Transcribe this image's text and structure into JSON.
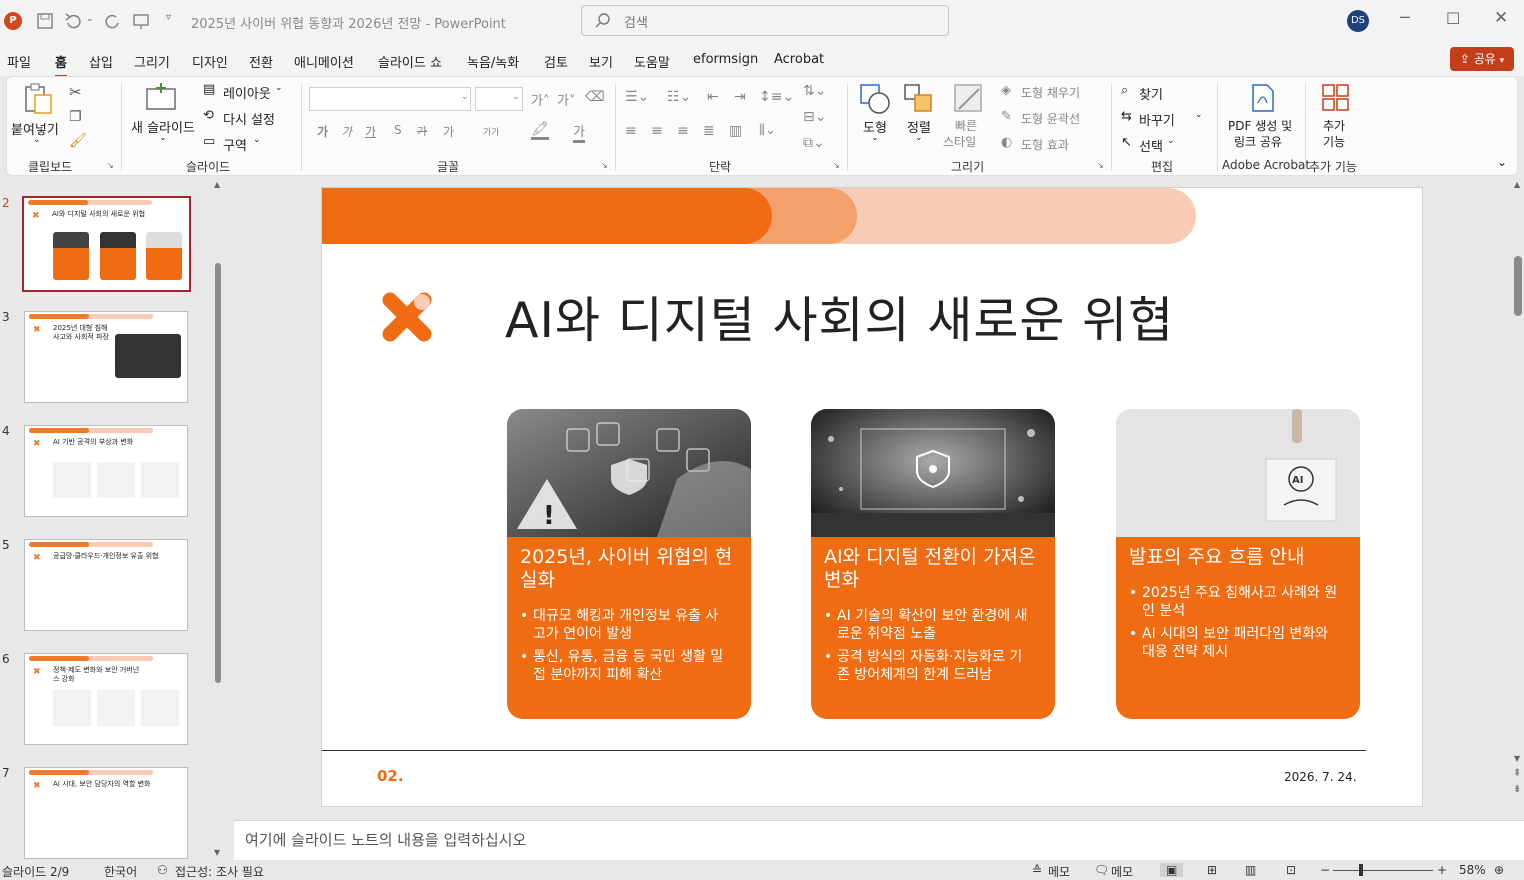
{
  "app": {
    "title": "2025년 사이버 위협 동향과 2026년 전망  -  PowerPoint",
    "search_placeholder": "검색",
    "user_initials": "DS",
    "share_label": "공유"
  },
  "menu": [
    "파일",
    "홈",
    "삽입",
    "그리기",
    "디자인",
    "전환",
    "애니메이션",
    "슬라이드 쇼",
    "녹음/녹화",
    "검토",
    "보기",
    "도움말",
    "eformsign",
    "Acrobat"
  ],
  "ribbon": {
    "paste": "붙여넣기",
    "new_slide": "새 슬라이드",
    "layout": "레이아웃",
    "reset": "다시 설정",
    "section": "구역",
    "font_buttons": [
      "가",
      "가",
      "가",
      "S",
      "가",
      "가",
      "가가"
    ],
    "shapes": "도형",
    "arrange": "정렬",
    "quick_styles_1": "빠른",
    "quick_styles_2": "스타일",
    "shape_fill": "도형 채우기",
    "shape_outline": "도형 윤곽선",
    "shape_effect": "도형 효과",
    "find": "찾기",
    "replace": "바꾸기",
    "select": "선택",
    "pdf_1": "PDF 생성 및",
    "pdf_2": "링크 공유",
    "addins_1": "추가",
    "addins_2": "기능",
    "groups": [
      "클립보드",
      "슬라이드",
      "글꼴",
      "단락",
      "그리기",
      "편집",
      "Adobe Acrobat",
      "추가 기능"
    ]
  },
  "thumbnails": [
    {
      "num": "2",
      "title": "AI와 디지털 사회의 새로운 위협"
    },
    {
      "num": "3",
      "title": "2025년 대형 침해사고와 사회적 파장"
    },
    {
      "num": "4",
      "title": "AI 기반 공격의 부상과 변화"
    },
    {
      "num": "5",
      "title": "공급망·클라우드·개인정보 유출 위협"
    },
    {
      "num": "6",
      "title": "정책·제도 변화와 보안 거버넌스 강화"
    },
    {
      "num": "7",
      "title": "AI 시대, 보안 담당자의 역할 변화"
    }
  ],
  "slide": {
    "title": "AI와 디지털 사회의 새로운 위협",
    "cards": [
      {
        "title": "2025년, 사이버 위협의 현실화",
        "bullets": [
          "대규모 해킹과 개인정보 유출 사고가 연이어 발생",
          "통신, 유통, 금융 등 국민 생활 밀접 분야까지 피해 확산"
        ]
      },
      {
        "title": "AI와 디지털 전환이 가져온 변화",
        "bullets": [
          "AI 기술의 확산이 보안 환경에 새로운 취약점 노출",
          "공격 방식의 자동화·지능화로 기존 방어체계의 한계 드러남"
        ]
      },
      {
        "title": "발표의 주요 흐름 안내",
        "bullets": [
          "2025년 주요 침해사고 사례와 원인 분석",
          "AI 시대의 보안 패러다임 변화와 대응 전략 제시"
        ]
      }
    ],
    "page_num": "02.",
    "date": "2026. 7. 24.",
    "cube_label": "AI"
  },
  "notes_placeholder": "여기에 슬라이드 노트의 내용을 입력하십시오",
  "status": {
    "slide": "슬라이드 2/9",
    "language": "한국어",
    "accessibility": "접근성: 조사 필요",
    "notes": "메모",
    "comments": "메모",
    "zoom": "58%"
  },
  "colors": {
    "accent": "#f06c13",
    "accent_mid": "#f4a06a",
    "accent_light": "#f8cbb4",
    "ppt_red": "#c43e1c"
  }
}
